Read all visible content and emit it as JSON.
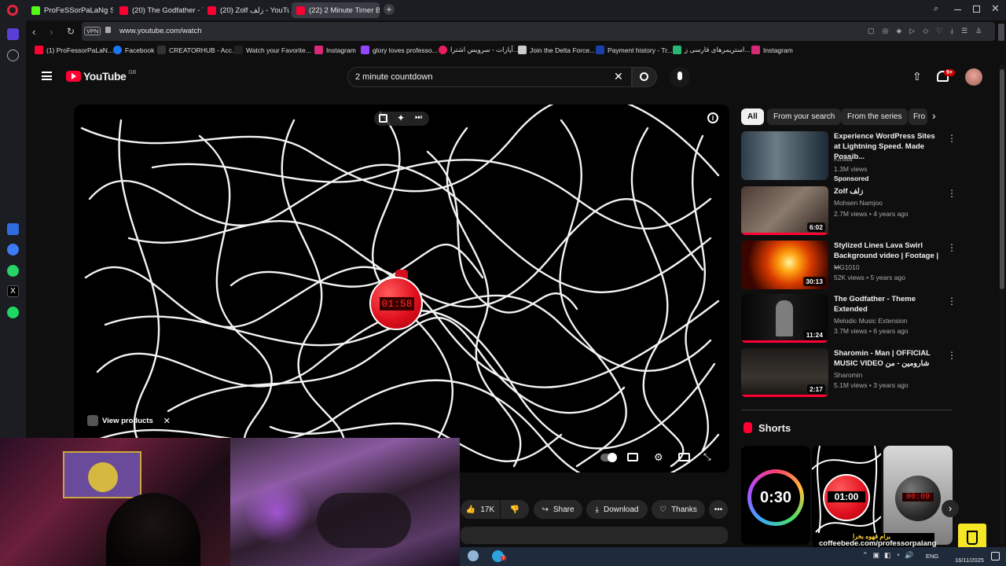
{
  "browser": {
    "tabs": [
      {
        "label": "ProFeSSorPaLaNg Stream"
      },
      {
        "label": "(20) The Godfather - Them"
      },
      {
        "label": "(20) Zolf زلف - YouTube"
      },
      {
        "label": "(22) 2 Minute Timer Bomb"
      }
    ],
    "vpn_label": "VPN",
    "url": "www.youtube.com/watch",
    "bookmarks": [
      {
        "label": "(1) ProFessorPaLaN..."
      },
      {
        "label": "Facebook"
      },
      {
        "label": "CREATORHUB - Acc..."
      },
      {
        "label": "Watch your Favorite..."
      },
      {
        "label": "Instagram"
      },
      {
        "label": "glory loves professo..."
      },
      {
        "label": "آپارات - سرویس اشترا..."
      },
      {
        "label": "Join the Delta Force..."
      },
      {
        "label": "Payment history - Tr..."
      },
      {
        "label": "استریمرهای فارسی ز..."
      },
      {
        "label": "Instagram"
      }
    ]
  },
  "youtube": {
    "logo_text": "YouTube",
    "region": "GB",
    "search_value": "2 minute countdown",
    "notification_count": "9+",
    "player": {
      "timer_display": "01:58",
      "view_products": "View products"
    },
    "actions": {
      "likes": "17K",
      "share": "Share",
      "download": "Download",
      "thanks": "Thanks"
    },
    "chips": [
      "All",
      "From your search",
      "From the series",
      "Fro"
    ],
    "recommendations": [
      {
        "title": "Experience WordPress Sites at Lightning Speed. Made Possib...",
        "channel": "Kinsta",
        "meta": "1.3M views",
        "extra": "Sponsored",
        "duration": ""
      },
      {
        "title": "Zolf زلف",
        "channel": "Mohsen Namjoo",
        "meta": "2.7M views • 4 years ago",
        "extra": "",
        "duration": "6:02"
      },
      {
        "title": "Stylized Lines Lava Swirl Background video | Footage | ...",
        "channel": "MG1010",
        "meta": "52K views • 5 years ago",
        "extra": "",
        "duration": "30:13"
      },
      {
        "title": "The Godfather - Theme Extended",
        "channel": "Melodic Music Extension",
        "meta": "3.7M views • 6 years ago",
        "extra": "",
        "duration": "11:24"
      },
      {
        "title": "Sharomin - Man | OFFICIAL MUSIC VIDEO شارومین - من",
        "channel": "Sharomin",
        "meta": "5.1M views • 3 years ago",
        "extra": "",
        "duration": "2:17"
      }
    ],
    "shorts_title": "Shorts",
    "shorts": [
      {
        "label": "0:30"
      },
      {
        "label": "01:00"
      },
      {
        "label": "00:09"
      }
    ]
  },
  "overlay": {
    "promo_text": "برام قهوه بخرا",
    "promo_url": "coffeebede.com/professorpalang"
  },
  "taskbar": {
    "badge": "7",
    "lang": "ENG",
    "date": "16/11/2025"
  },
  "colors": {
    "yt_red": "#ff0033",
    "bg": "#0f0f0f",
    "chip_bg": "#272727"
  }
}
